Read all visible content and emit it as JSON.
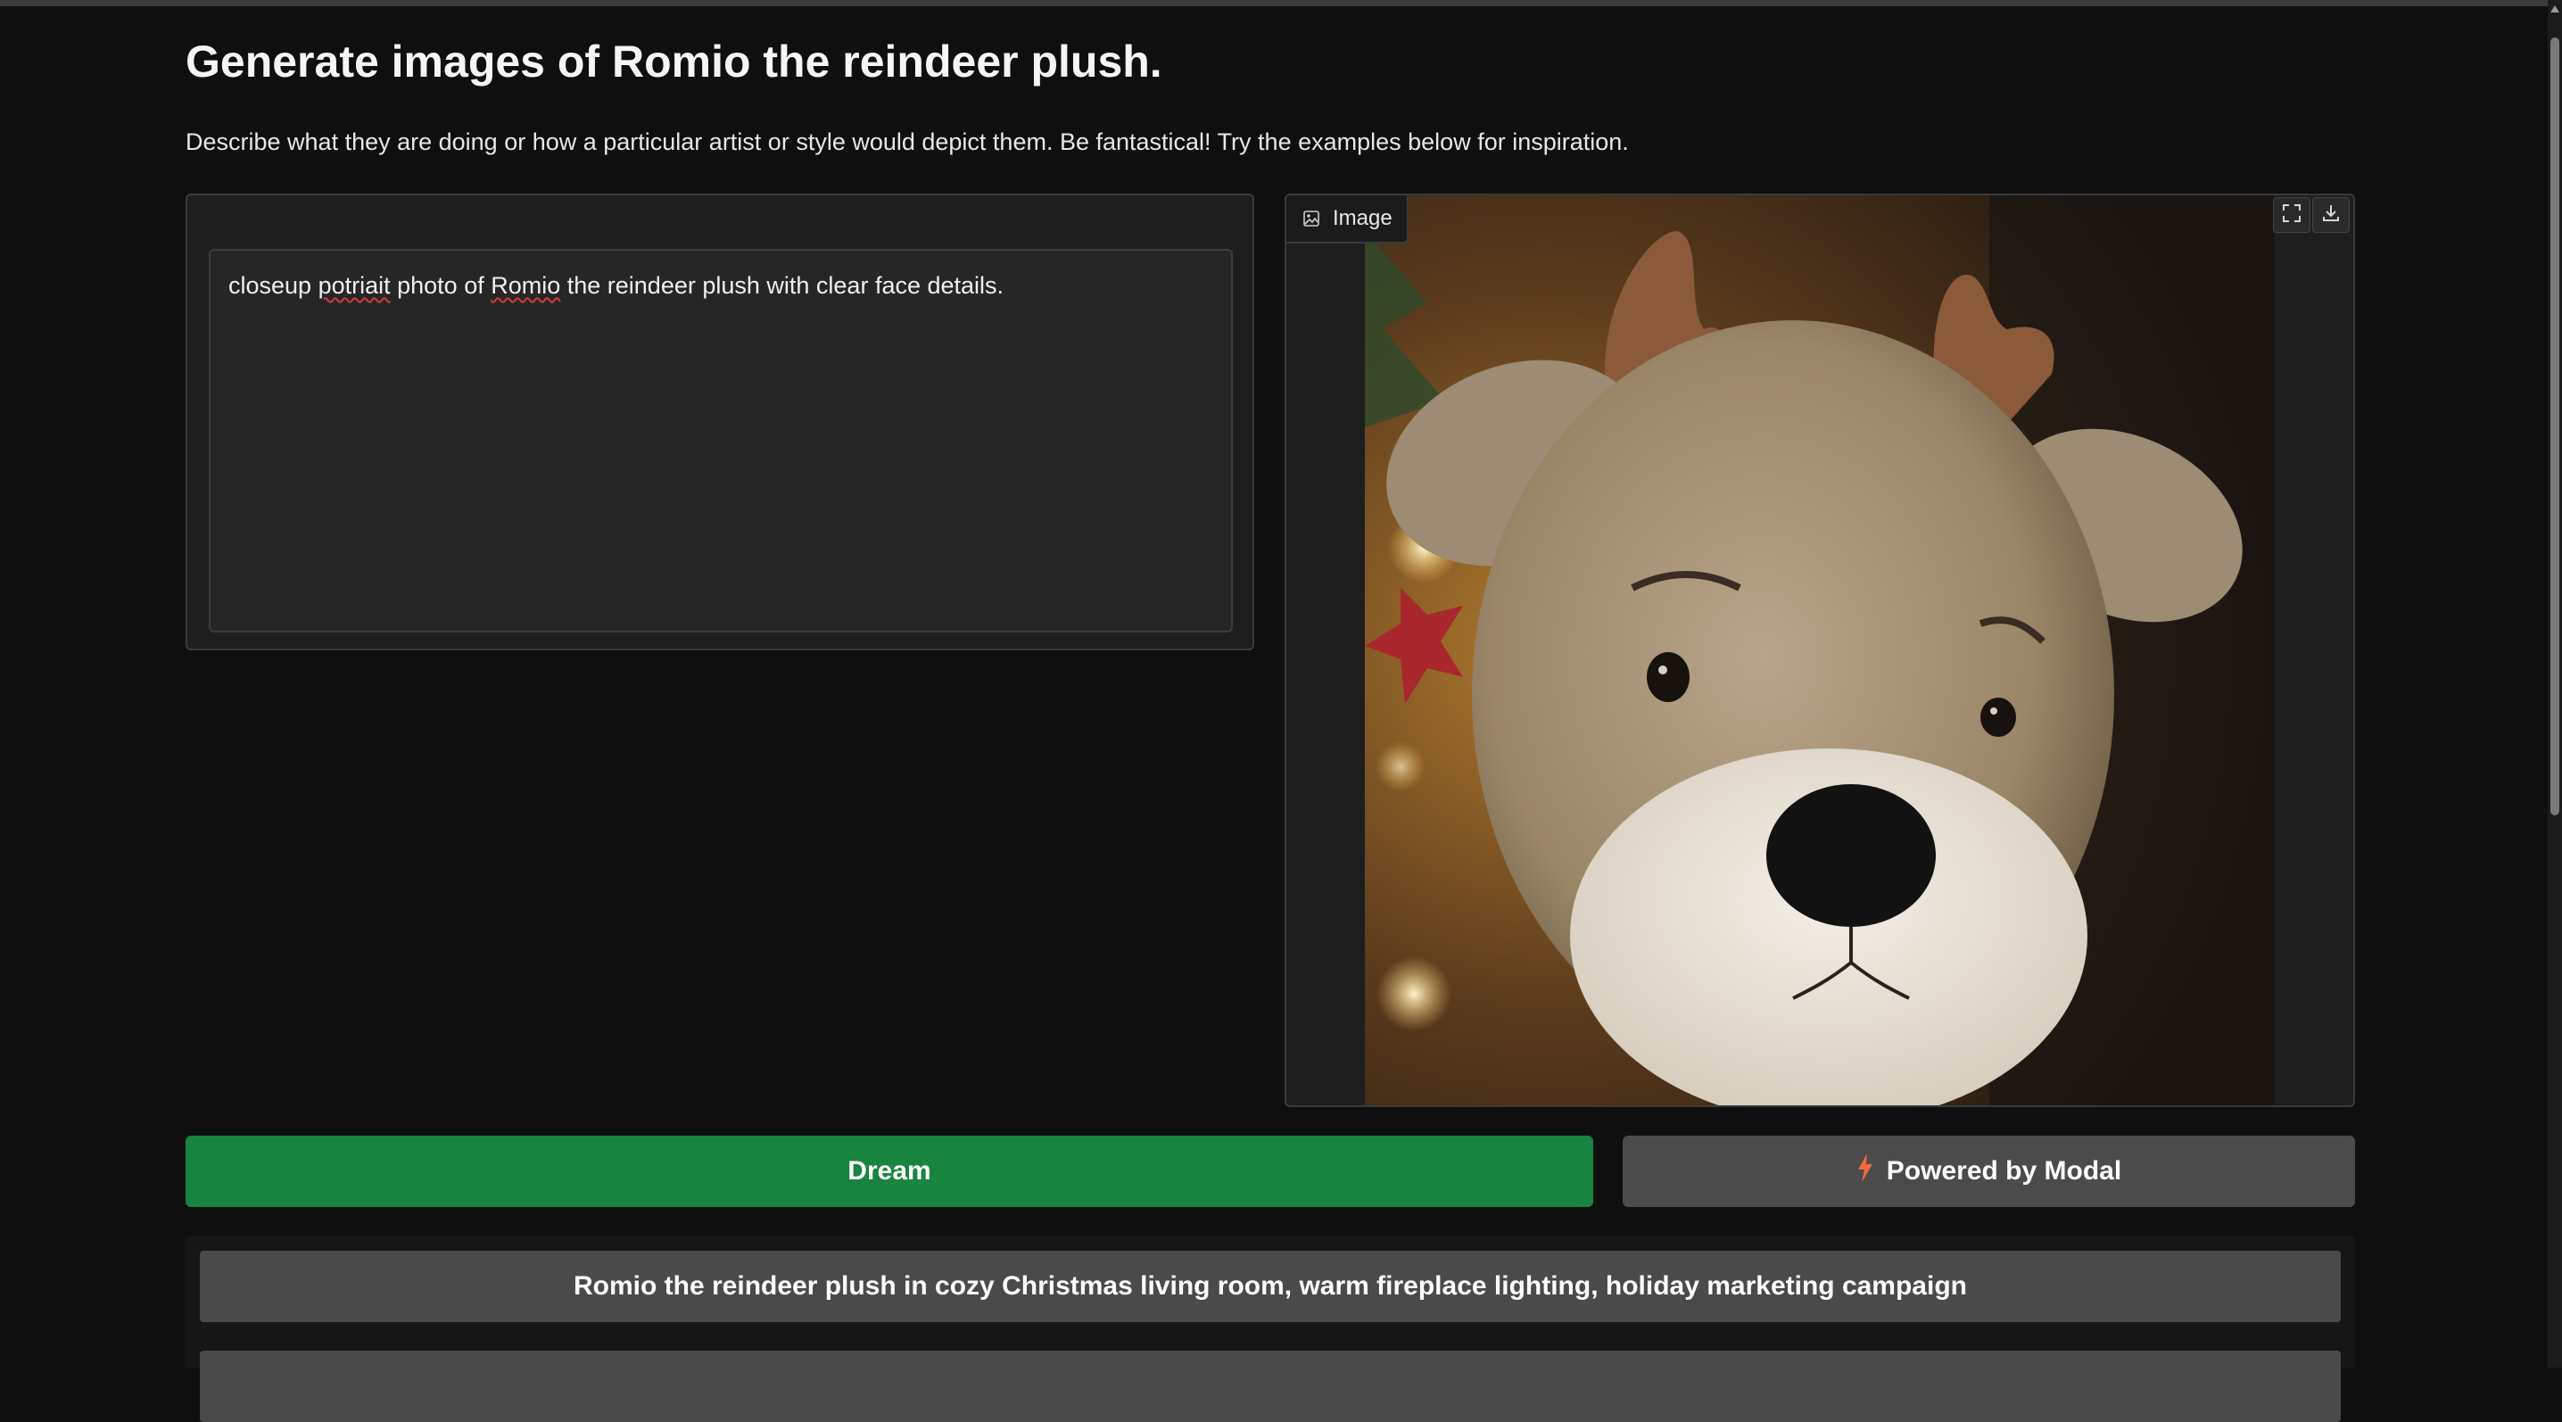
{
  "header": {
    "title": "Generate images of Romio the reindeer plush.",
    "description": "Describe what they are doing or how a particular artist or style would depict them. Be fantastical! Try the examples below for inspiration."
  },
  "prompt": {
    "value_parts": [
      "closeup ",
      "potriait",
      " photo of ",
      "Romio",
      " the reindeer plush with clear face details."
    ]
  },
  "output": {
    "label": "Image",
    "image_icon": "image-icon",
    "fullscreen_icon": "fullscreen-icon",
    "download_icon": "download-icon"
  },
  "actions": {
    "dream_label": "Dream",
    "modal_label": "Powered by Modal",
    "modal_icon": "lightning-icon"
  },
  "examples": [
    "Romio the reindeer plush in cozy Christmas living room, warm fireplace lighting, holiday marketing campaign",
    ""
  ],
  "colors": {
    "dream_button": "#17843f",
    "modal_button": "#4b4b4b",
    "background": "#0f0f0f",
    "lightning": "#f26b3a"
  }
}
